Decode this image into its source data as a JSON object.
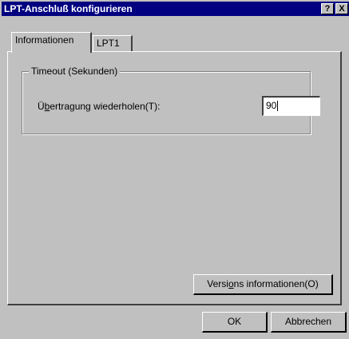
{
  "window": {
    "title": "LPT-Anschluß konfigurieren",
    "help_button": "?",
    "close_button": "X"
  },
  "tabs": [
    {
      "label": "Informationen",
      "active": true
    },
    {
      "label": "LPT1",
      "active": false
    }
  ],
  "timeout_group": {
    "legend": "Timeout (Sekunden)",
    "retry_label_prefix": "Ü",
    "retry_label_underlined": "b",
    "retry_label_suffix": "ertragung wiederholen(T):",
    "retry_value": "90"
  },
  "buttons": {
    "version_prefix": "Versi",
    "version_underlined": "o",
    "version_suffix": "ns informationen(O)",
    "ok": "OK",
    "cancel": "Abbrechen"
  }
}
